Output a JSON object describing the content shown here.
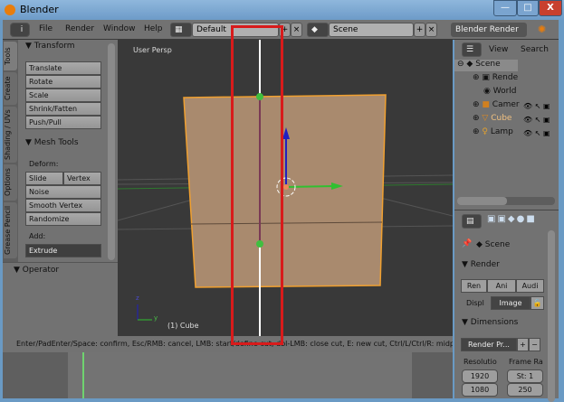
{
  "window": {
    "title": "Blender",
    "minimize": "—",
    "maximize": "□",
    "close": "X"
  },
  "menubar": {
    "info_icon": "i",
    "items": [
      "File",
      "Render",
      "Window",
      "Help"
    ],
    "screen_layout": "Default",
    "scene": "Scene",
    "render_engine": "Blender Render"
  },
  "left_tabs": [
    "Tools",
    "Create",
    "Shading / UVs",
    "Options",
    "Grease Pencil"
  ],
  "tool_panel": {
    "transform_header": "Transform",
    "transform_buttons": [
      "Translate",
      "Rotate",
      "Scale",
      "Shrink/Fatten",
      "Push/Pull"
    ],
    "mesh_tools_header": "Mesh Tools",
    "deform_label": "Deform:",
    "slide_edge": "Slide Edg",
    "vertex": "Vertex",
    "deform_buttons": [
      "Noise",
      "Smooth Vertex",
      "Randomize"
    ],
    "add_label": "Add:",
    "extrude": "Extrude"
  },
  "operator_panel": {
    "header": "Operator"
  },
  "viewport": {
    "view_label": "User Persp",
    "object_label": "(1) Cube",
    "axis_z": "z",
    "axis_y": "y"
  },
  "status_bar": {
    "text": "Enter/PadEnter/Space: confirm, Esc/RMB: cancel, LMB: start/define cut, dbl-LMB: close cut, E: new cut, Ctrl/L/Ctrl/R: midpoint snap"
  },
  "outliner": {
    "view": "View",
    "search": "Search",
    "items": [
      {
        "label": "Scene",
        "level": 0
      },
      {
        "label": "Rende",
        "level": 1
      },
      {
        "label": "World",
        "level": 1
      },
      {
        "label": "Camer",
        "level": 1
      },
      {
        "label": "Cube",
        "level": 1
      },
      {
        "label": "Lamp",
        "level": 1
      }
    ]
  },
  "properties": {
    "context": "Scene",
    "render_header": "Render",
    "render_buttons": [
      "Ren",
      "Ani",
      "Audi"
    ],
    "display_label": "Displ",
    "display_value": "Image",
    "dimensions_header": "Dimensions",
    "preset": "Render Pr...",
    "resolution_label": "Resolutio",
    "frame_range_label": "Frame Ra",
    "res_x": "1920",
    "res_y": "1080",
    "frame_start": "St: 1",
    "frame_end": "250"
  },
  "colors": {
    "accent_red": "#d81b1b",
    "mesh_face": "#a98a6e",
    "selected_edge": "#f0a030"
  }
}
